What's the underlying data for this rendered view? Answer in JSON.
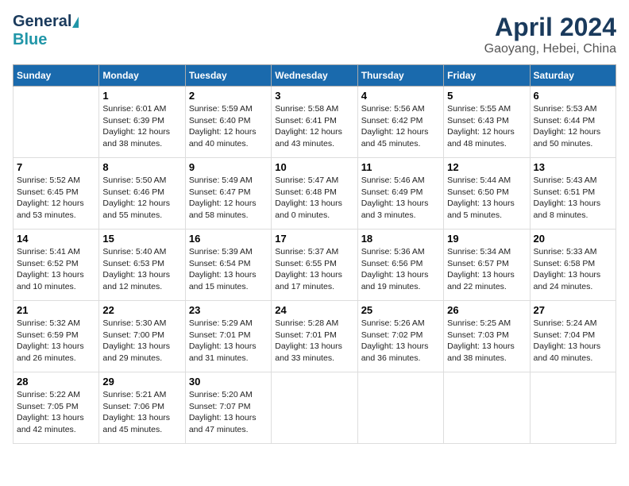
{
  "header": {
    "logo_general": "General",
    "logo_blue": "Blue",
    "title": "April 2024",
    "subtitle": "Gaoyang, Hebei, China"
  },
  "calendar": {
    "days_of_week": [
      "Sunday",
      "Monday",
      "Tuesday",
      "Wednesday",
      "Thursday",
      "Friday",
      "Saturday"
    ],
    "weeks": [
      [
        {
          "day": "",
          "info": ""
        },
        {
          "day": "1",
          "info": "Sunrise: 6:01 AM\nSunset: 6:39 PM\nDaylight: 12 hours\nand 38 minutes."
        },
        {
          "day": "2",
          "info": "Sunrise: 5:59 AM\nSunset: 6:40 PM\nDaylight: 12 hours\nand 40 minutes."
        },
        {
          "day": "3",
          "info": "Sunrise: 5:58 AM\nSunset: 6:41 PM\nDaylight: 12 hours\nand 43 minutes."
        },
        {
          "day": "4",
          "info": "Sunrise: 5:56 AM\nSunset: 6:42 PM\nDaylight: 12 hours\nand 45 minutes."
        },
        {
          "day": "5",
          "info": "Sunrise: 5:55 AM\nSunset: 6:43 PM\nDaylight: 12 hours\nand 48 minutes."
        },
        {
          "day": "6",
          "info": "Sunrise: 5:53 AM\nSunset: 6:44 PM\nDaylight: 12 hours\nand 50 minutes."
        }
      ],
      [
        {
          "day": "7",
          "info": "Sunrise: 5:52 AM\nSunset: 6:45 PM\nDaylight: 12 hours\nand 53 minutes."
        },
        {
          "day": "8",
          "info": "Sunrise: 5:50 AM\nSunset: 6:46 PM\nDaylight: 12 hours\nand 55 minutes."
        },
        {
          "day": "9",
          "info": "Sunrise: 5:49 AM\nSunset: 6:47 PM\nDaylight: 12 hours\nand 58 minutes."
        },
        {
          "day": "10",
          "info": "Sunrise: 5:47 AM\nSunset: 6:48 PM\nDaylight: 13 hours\nand 0 minutes."
        },
        {
          "day": "11",
          "info": "Sunrise: 5:46 AM\nSunset: 6:49 PM\nDaylight: 13 hours\nand 3 minutes."
        },
        {
          "day": "12",
          "info": "Sunrise: 5:44 AM\nSunset: 6:50 PM\nDaylight: 13 hours\nand 5 minutes."
        },
        {
          "day": "13",
          "info": "Sunrise: 5:43 AM\nSunset: 6:51 PM\nDaylight: 13 hours\nand 8 minutes."
        }
      ],
      [
        {
          "day": "14",
          "info": "Sunrise: 5:41 AM\nSunset: 6:52 PM\nDaylight: 13 hours\nand 10 minutes."
        },
        {
          "day": "15",
          "info": "Sunrise: 5:40 AM\nSunset: 6:53 PM\nDaylight: 13 hours\nand 12 minutes."
        },
        {
          "day": "16",
          "info": "Sunrise: 5:39 AM\nSunset: 6:54 PM\nDaylight: 13 hours\nand 15 minutes."
        },
        {
          "day": "17",
          "info": "Sunrise: 5:37 AM\nSunset: 6:55 PM\nDaylight: 13 hours\nand 17 minutes."
        },
        {
          "day": "18",
          "info": "Sunrise: 5:36 AM\nSunset: 6:56 PM\nDaylight: 13 hours\nand 19 minutes."
        },
        {
          "day": "19",
          "info": "Sunrise: 5:34 AM\nSunset: 6:57 PM\nDaylight: 13 hours\nand 22 minutes."
        },
        {
          "day": "20",
          "info": "Sunrise: 5:33 AM\nSunset: 6:58 PM\nDaylight: 13 hours\nand 24 minutes."
        }
      ],
      [
        {
          "day": "21",
          "info": "Sunrise: 5:32 AM\nSunset: 6:59 PM\nDaylight: 13 hours\nand 26 minutes."
        },
        {
          "day": "22",
          "info": "Sunrise: 5:30 AM\nSunset: 7:00 PM\nDaylight: 13 hours\nand 29 minutes."
        },
        {
          "day": "23",
          "info": "Sunrise: 5:29 AM\nSunset: 7:01 PM\nDaylight: 13 hours\nand 31 minutes."
        },
        {
          "day": "24",
          "info": "Sunrise: 5:28 AM\nSunset: 7:01 PM\nDaylight: 13 hours\nand 33 minutes."
        },
        {
          "day": "25",
          "info": "Sunrise: 5:26 AM\nSunset: 7:02 PM\nDaylight: 13 hours\nand 36 minutes."
        },
        {
          "day": "26",
          "info": "Sunrise: 5:25 AM\nSunset: 7:03 PM\nDaylight: 13 hours\nand 38 minutes."
        },
        {
          "day": "27",
          "info": "Sunrise: 5:24 AM\nSunset: 7:04 PM\nDaylight: 13 hours\nand 40 minutes."
        }
      ],
      [
        {
          "day": "28",
          "info": "Sunrise: 5:22 AM\nSunset: 7:05 PM\nDaylight: 13 hours\nand 42 minutes."
        },
        {
          "day": "29",
          "info": "Sunrise: 5:21 AM\nSunset: 7:06 PM\nDaylight: 13 hours\nand 45 minutes."
        },
        {
          "day": "30",
          "info": "Sunrise: 5:20 AM\nSunset: 7:07 PM\nDaylight: 13 hours\nand 47 minutes."
        },
        {
          "day": "",
          "info": ""
        },
        {
          "day": "",
          "info": ""
        },
        {
          "day": "",
          "info": ""
        },
        {
          "day": "",
          "info": ""
        }
      ]
    ]
  }
}
